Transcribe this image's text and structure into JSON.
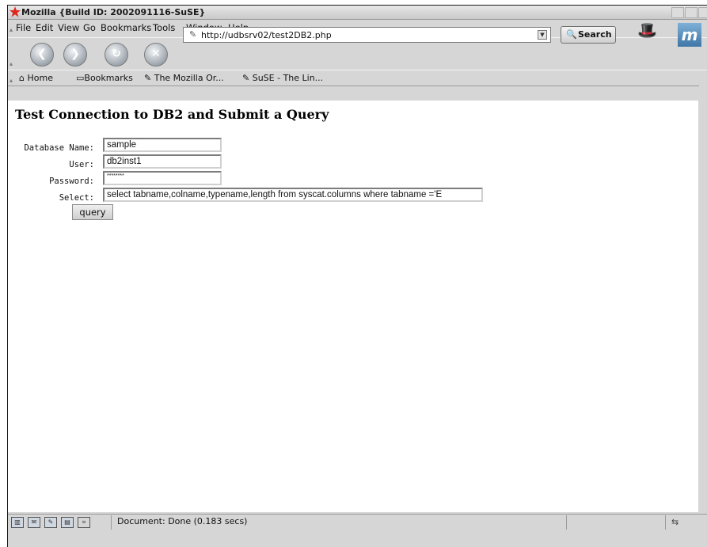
{
  "window": {
    "title": "Mozilla {Build ID: 2002091116-SuSE}"
  },
  "menubar": {
    "items": [
      {
        "label": "File"
      },
      {
        "label": "Edit"
      },
      {
        "label": "View"
      },
      {
        "label": "Go"
      },
      {
        "label": "Bookmarks"
      },
      {
        "label": "Tools"
      },
      {
        "label": "Window"
      },
      {
        "label": "Help"
      }
    ]
  },
  "navbar": {
    "url": "http://udbsrv02/test2DB2.php",
    "search_label": "Search"
  },
  "personal_toolbar": {
    "items": [
      {
        "label": "Home",
        "icon": "home-icon"
      },
      {
        "label": "Bookmarks",
        "icon": "folder-icon"
      },
      {
        "label": "The Mozilla Or...",
        "icon": "bookmark-icon"
      },
      {
        "label": "SuSE - The Lin...",
        "icon": "bookmark-icon"
      }
    ]
  },
  "page": {
    "heading": "Test Connection to DB2 and Submit a Query",
    "fields": {
      "database": {
        "label": "Database Name:",
        "value": "sample"
      },
      "user": {
        "label": "User:",
        "value": "db2inst1"
      },
      "password": {
        "label": "Password:",
        "value": "********"
      },
      "select": {
        "label": "Select:",
        "value": "select tabname,colname,typename,length from syscat.columns where tabname ='E"
      }
    },
    "query_button": "query"
  },
  "statusbar": {
    "text": "Document: Done (0.183 secs)"
  }
}
